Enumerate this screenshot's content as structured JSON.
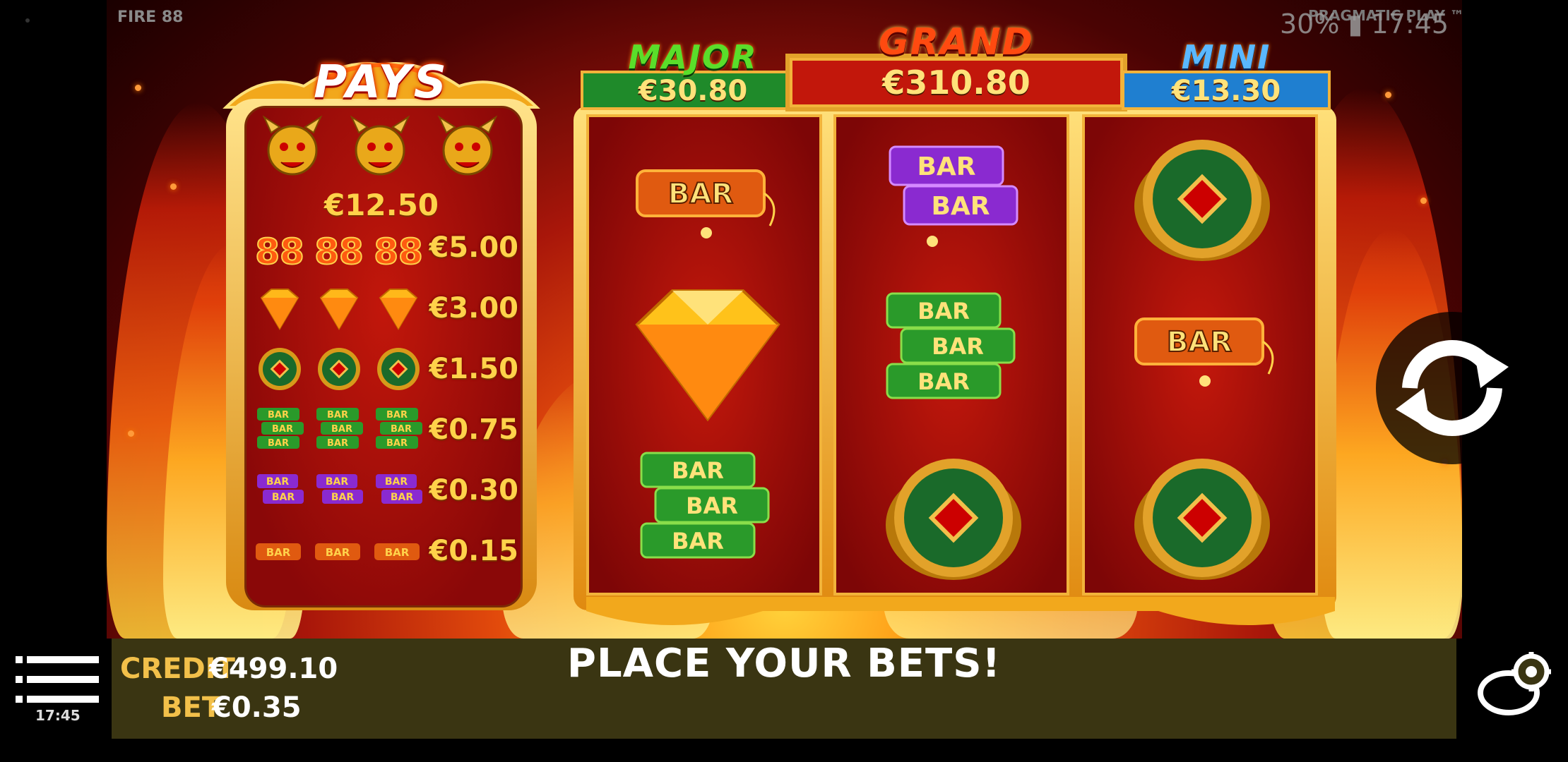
{
  "header": {
    "game_title": "FIRE 88",
    "brand": "PRAGMATIC PLAY ™",
    "status": "30% ▮ 17:45"
  },
  "pays": {
    "title": "PAYS",
    "icon_names": [
      "golden-dragon-icon",
      "fire-88-icon",
      "gem-icon",
      "coin-icon",
      "green-bar-icon",
      "purple-bar-icon",
      "orange-bar-icon"
    ],
    "rows": [
      {
        "symbol": "golden-dragon",
        "value": "€12.50"
      },
      {
        "symbol": "fire-88",
        "value": "€5.00"
      },
      {
        "symbol": "gem",
        "value": "€3.00"
      },
      {
        "symbol": "coin",
        "value": "€1.50"
      },
      {
        "symbol": "triple-bar",
        "value": "€0.75"
      },
      {
        "symbol": "double-bar",
        "value": "€0.30"
      },
      {
        "symbol": "single-bar",
        "value": "€0.15"
      }
    ]
  },
  "jackpots": {
    "major": {
      "label": "MAJOR",
      "value": "€30.80"
    },
    "grand": {
      "label": "GRAND",
      "value": "€310.80"
    },
    "mini": {
      "label": "MINI",
      "value": "€13.30"
    }
  },
  "reels": [
    [
      "single-bar",
      "gem",
      "triple-bar"
    ],
    [
      "double-bar",
      "triple-bar",
      "coin"
    ],
    [
      "coin",
      "single-bar",
      "coin"
    ]
  ],
  "bar_text": "BAR",
  "bottom": {
    "credit_label": "CREDIT",
    "credit_value": "€499.10",
    "bet_label": "BET",
    "bet_value": "€0.35",
    "message": "PLACE YOUR BETS!",
    "time": "17:45"
  },
  "colors": {
    "gold": "#ffd24a",
    "reel_red": "#b4140a",
    "jackpot_green": "#1f8a2a",
    "jackpot_red": "#c2170b",
    "jackpot_blue": "#1f7fd0",
    "bottom_bar": "#3a3512"
  }
}
